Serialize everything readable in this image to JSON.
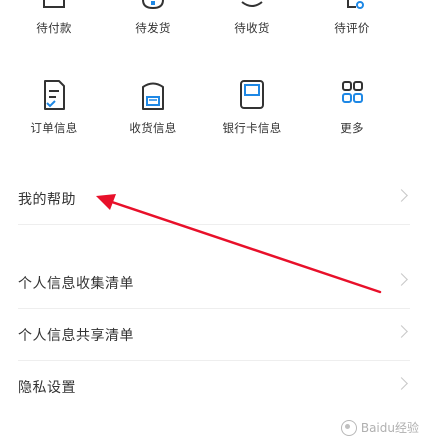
{
  "services_row1": [
    {
      "label": "待付款",
      "icon": "wallet-icon"
    },
    {
      "label": "待发货",
      "icon": "box-icon"
    },
    {
      "label": "待收货",
      "icon": "truck-icon"
    },
    {
      "label": "待评价",
      "icon": "comment-icon"
    }
  ],
  "services_row2": [
    {
      "label": "订单信息",
      "icon": "order-icon"
    },
    {
      "label": "收货信息",
      "icon": "address-card-icon"
    },
    {
      "label": "银行卡信息",
      "icon": "bank-card-icon"
    },
    {
      "label": "更多",
      "icon": "grid-icon"
    }
  ],
  "menu": [
    {
      "label": "我的帮助"
    },
    {
      "label": "个人信息收集清单"
    },
    {
      "label": "个人信息共享清单"
    },
    {
      "label": "隐私设置"
    }
  ],
  "watermark": {
    "text": "Baidu经验"
  },
  "colors": {
    "accent": "#1e88e5",
    "annotation_arrow": "#e8102a"
  }
}
